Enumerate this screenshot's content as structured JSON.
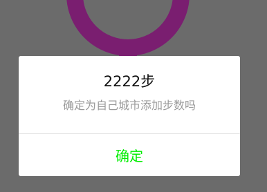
{
  "background": {
    "icon": "female-symbol-icon",
    "overlay_color": "#6b6b6b",
    "symbol_color": "#7a1e70"
  },
  "dialog": {
    "title": "2222步",
    "message": "确定为自己城市添加步数吗",
    "confirm_label": "确定",
    "confirm_color": "#00ee00"
  }
}
